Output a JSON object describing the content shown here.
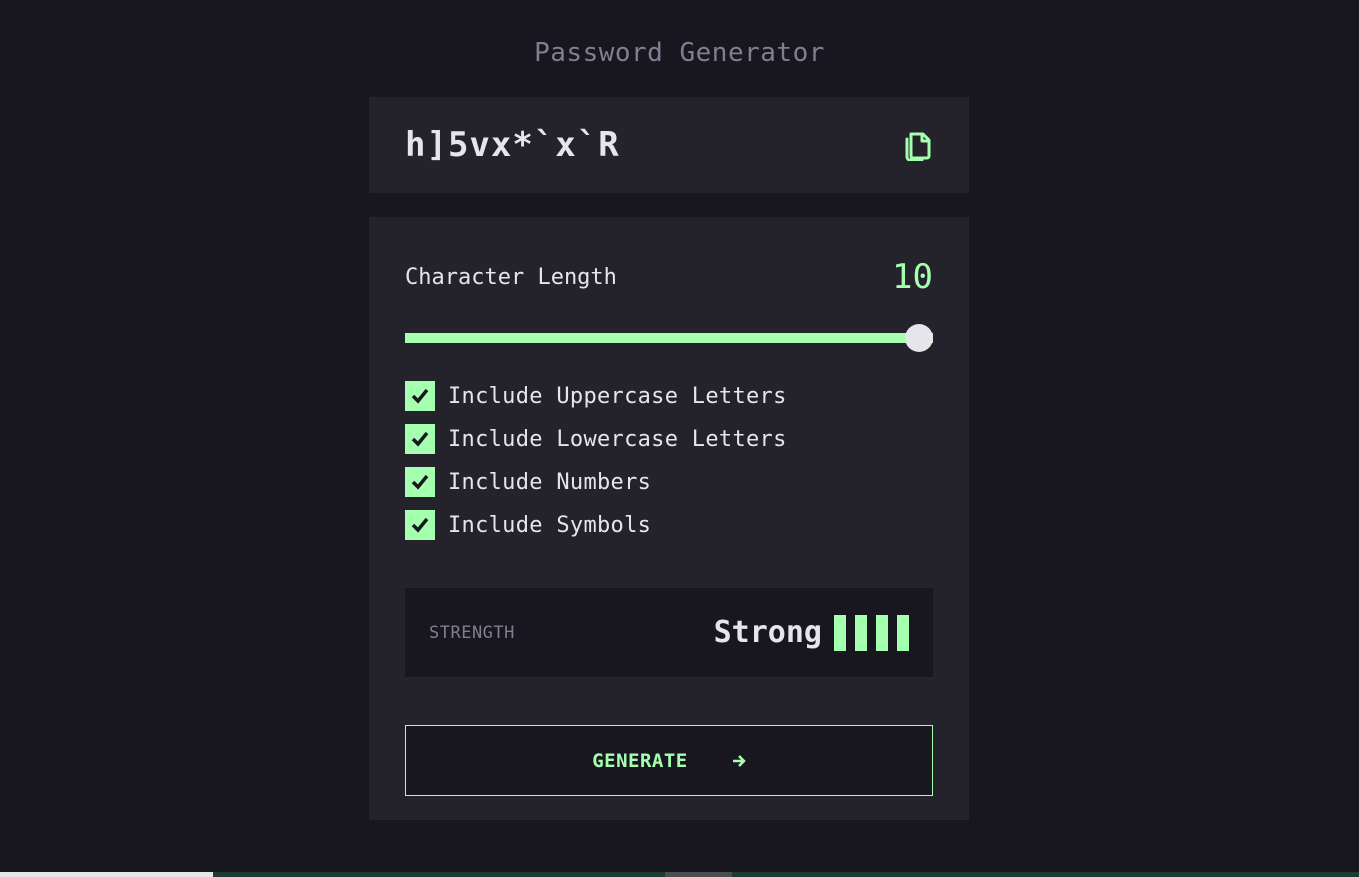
{
  "app": {
    "title": "Password Generator"
  },
  "password": {
    "value": "h]5vx*`x`R",
    "copy_icon": "copy-icon"
  },
  "length": {
    "label": "Character Length",
    "value": "10",
    "slider_fraction": 1.0
  },
  "options": [
    {
      "label": "Include Uppercase Letters",
      "checked": true
    },
    {
      "label": "Include Lowercase Letters",
      "checked": true
    },
    {
      "label": "Include Numbers",
      "checked": true
    },
    {
      "label": "Include Symbols",
      "checked": true
    }
  ],
  "strength": {
    "label": "STRENGTH",
    "value": "Strong",
    "level": 4,
    "max_level": 4
  },
  "generate": {
    "label": "GENERATE",
    "icon": "arrow-right-icon"
  },
  "colors": {
    "background": "#18171f",
    "panel": "#24232c",
    "accent": "#a4ffaf",
    "text": "#e6e5ea",
    "muted": "#817d92"
  }
}
